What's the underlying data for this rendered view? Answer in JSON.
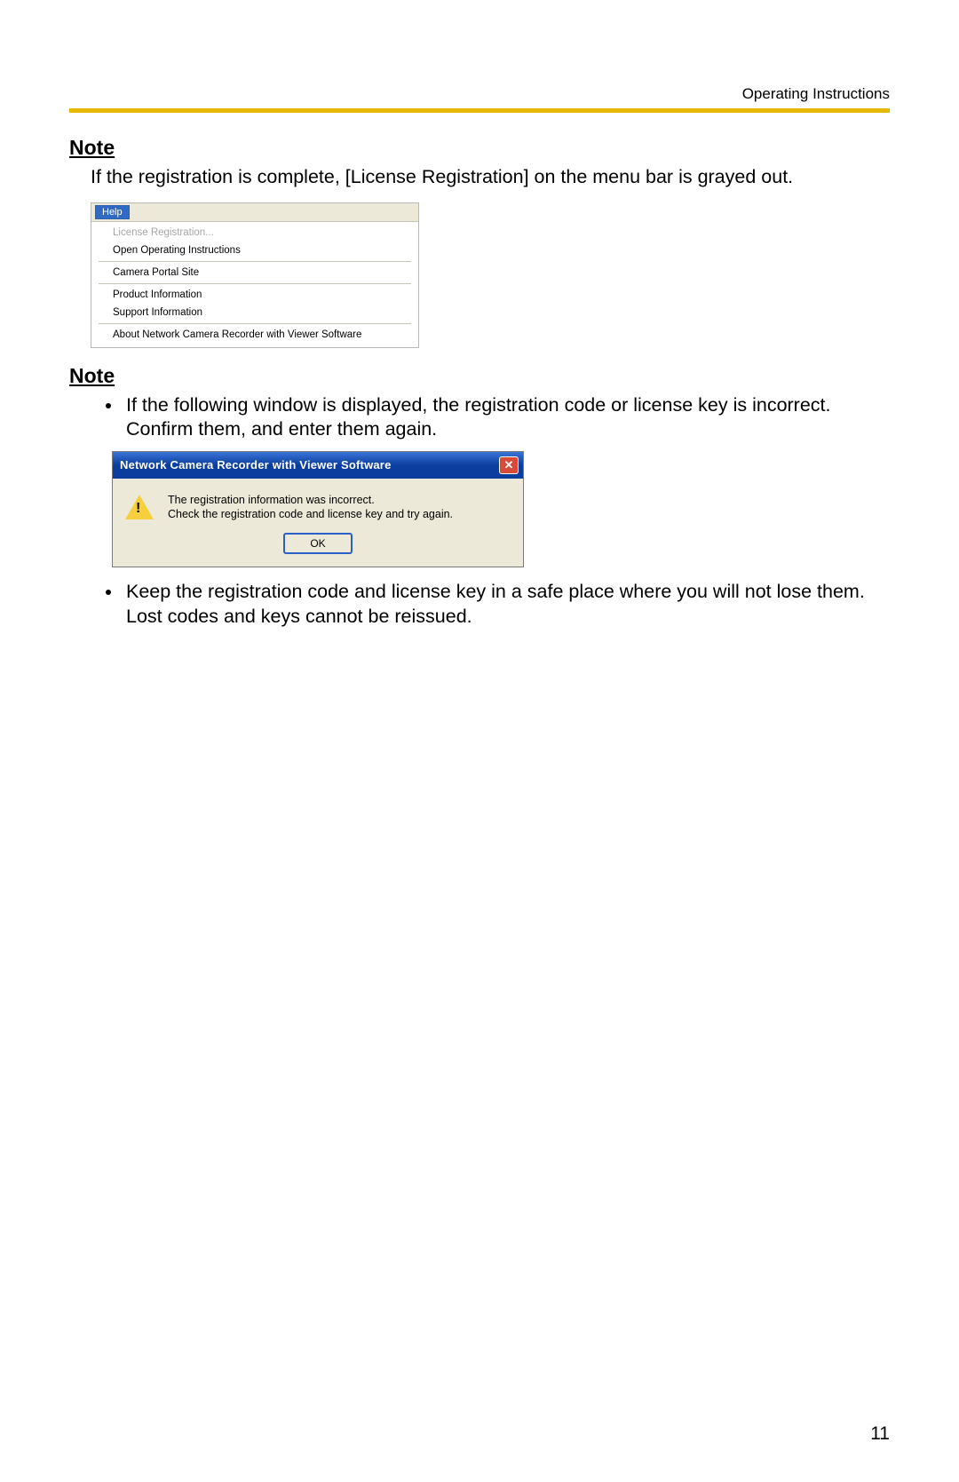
{
  "header": {
    "right": "Operating Instructions"
  },
  "note1": {
    "heading": "Note",
    "text": "If the registration is complete, [License Registration] on the menu bar is grayed out."
  },
  "help_menu": {
    "button": "Help",
    "items": [
      {
        "label": "License Registration...",
        "disabled": true
      },
      {
        "label": "Open Operating Instructions",
        "disabled": false
      },
      {
        "label": "Camera Portal Site",
        "disabled": false
      },
      {
        "label": "Product Information",
        "disabled": false
      },
      {
        "label": "Support Information",
        "disabled": false
      },
      {
        "label": "About Network Camera Recorder with Viewer Software",
        "disabled": false
      }
    ]
  },
  "note2": {
    "heading": "Note",
    "bullet1": "If the following window is displayed, the registration code or license key is incorrect. Confirm them, and enter them again.",
    "bullet2_line1": "Keep the registration code and license key in a safe place where you will not lose them.",
    "bullet2_line2": "Lost codes and keys cannot be reissued."
  },
  "dialog": {
    "title": "Network Camera Recorder with Viewer Software",
    "line1": "The registration information was incorrect.",
    "line2": "Check the registration code and license key and try again.",
    "ok": "OK",
    "close": "✕"
  },
  "page_number": "11"
}
